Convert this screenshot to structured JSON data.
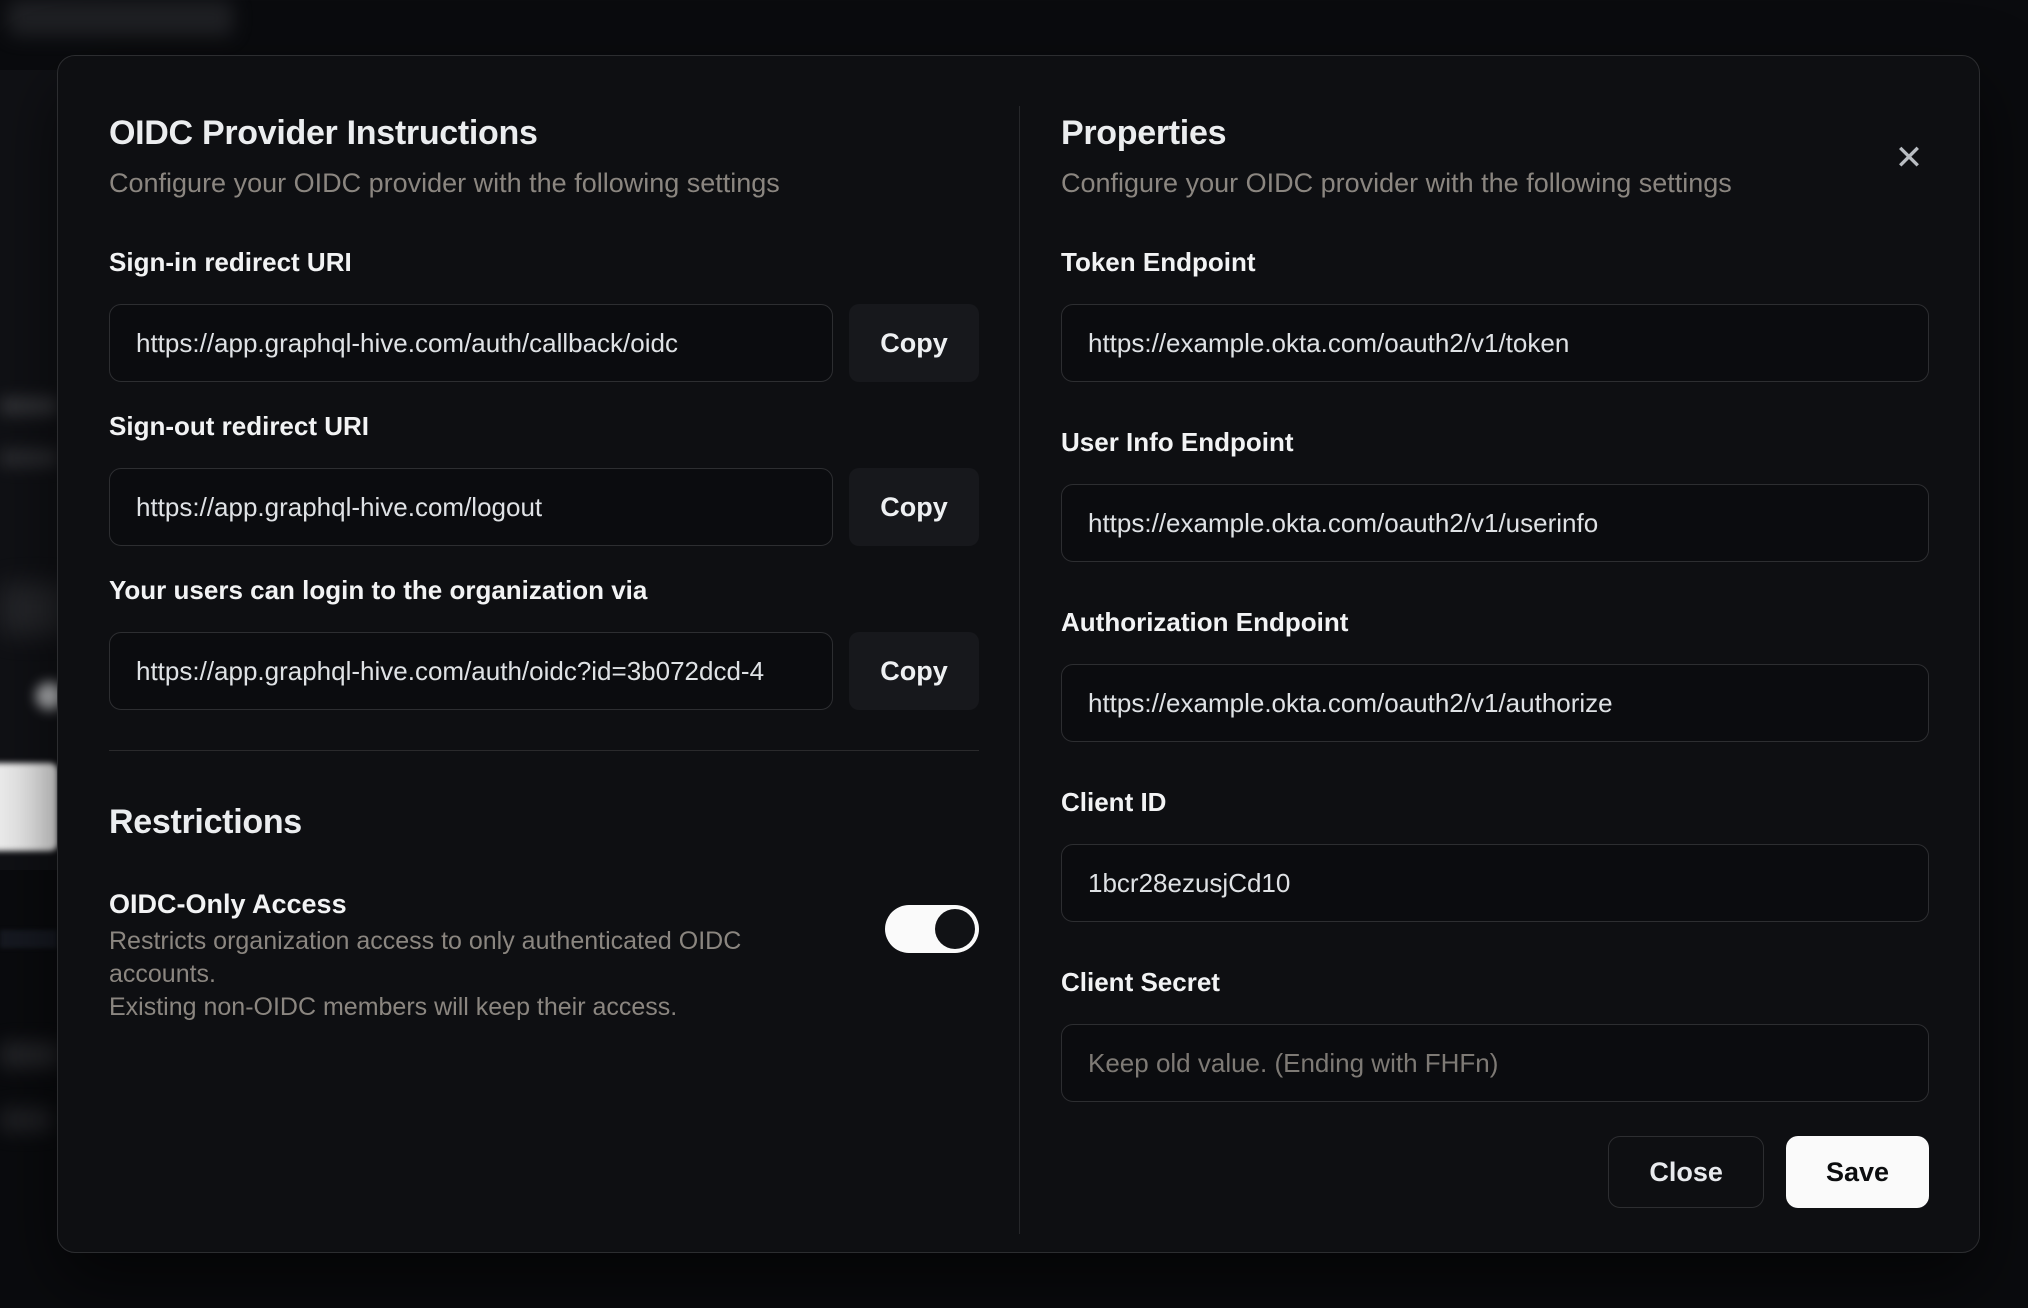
{
  "modal": {
    "close_icon": "✕",
    "left": {
      "title": "OIDC Provider Instructions",
      "subtitle": "Configure your OIDC provider with the following settings",
      "fields": [
        {
          "label": "Sign-in redirect URI",
          "value": "https://app.graphql-hive.com/auth/callback/oidc",
          "copy_label": "Copy"
        },
        {
          "label": "Sign-out redirect URI",
          "value": "https://app.graphql-hive.com/logout",
          "copy_label": "Copy"
        },
        {
          "label": "Your users can login to the organization via",
          "value": "https://app.graphql-hive.com/auth/oidc?id=3b072dcd-4",
          "copy_label": "Copy"
        }
      ],
      "restrictions": {
        "title": "Restrictions",
        "toggle_label": "OIDC-Only Access",
        "toggle_description_line1": "Restricts organization access to only authenticated OIDC accounts.",
        "toggle_description_line2": "Existing non-OIDC members will keep their access.",
        "toggle_state": "on"
      }
    },
    "right": {
      "title": "Properties",
      "subtitle": "Configure your OIDC provider with the following settings",
      "fields": [
        {
          "label": "Token Endpoint",
          "value": "https://example.okta.com/oauth2/v1/token"
        },
        {
          "label": "User Info Endpoint",
          "value": "https://example.okta.com/oauth2/v1/userinfo"
        },
        {
          "label": "Authorization Endpoint",
          "value": "https://example.okta.com/oauth2/v1/authorize"
        },
        {
          "label": "Client ID",
          "value": "1bcr28ezusjCd10"
        },
        {
          "label": "Client Secret",
          "value": "",
          "placeholder": "Keep old value. (Ending with FHFn)"
        }
      ],
      "buttons": {
        "close": "Close",
        "save": "Save"
      }
    }
  },
  "colors": {
    "page_bg": "#0a0b0e",
    "modal_bg": "#0e0f12",
    "modal_border": "#2c2d30",
    "input_bg": "#0b0c0f",
    "input_border": "#2d2e31",
    "copy_button_bg": "#17181c",
    "save_button_bg": "#fafafa",
    "save_button_text": "#0c0d0f",
    "toggle_track": "#fafafa",
    "toggle_knob": "#111215",
    "heading_text": "#ebedef",
    "muted_text": "#8b8680"
  }
}
